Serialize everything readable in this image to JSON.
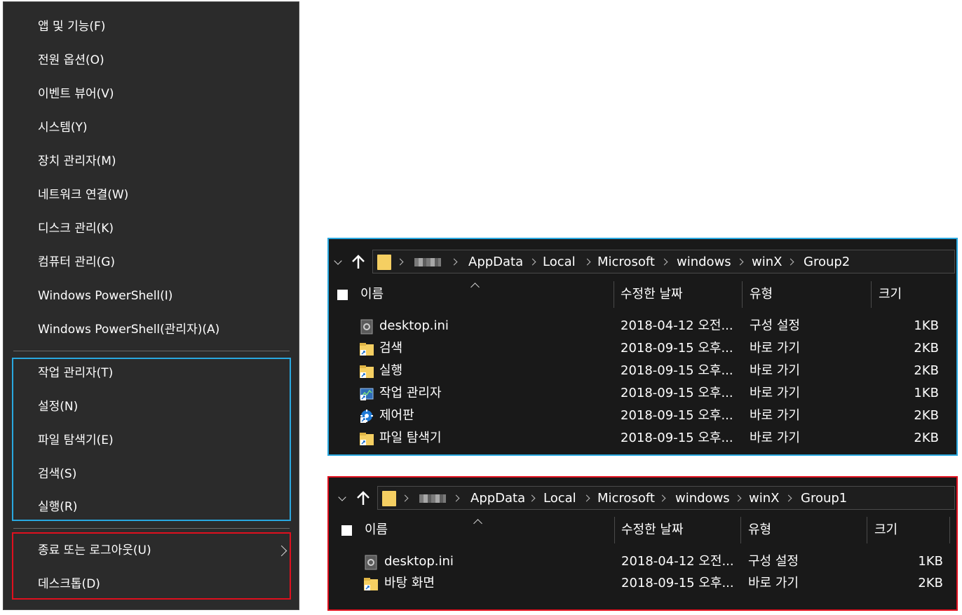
{
  "winx_menu": {
    "items_top": [
      "앱 및 기능(F)",
      "전원 옵션(O)",
      "이벤트 뷰어(V)",
      "시스템(Y)",
      "장치 관리자(M)",
      "네트워크 연결(W)",
      "디스크 관리(K)",
      "컴퓨터 관리(G)",
      "Windows PowerShell(I)",
      "Windows PowerShell(관리자)(A)"
    ],
    "items_group2": [
      "작업 관리자(T)",
      "설정(N)",
      "파일 탐색기(E)",
      "검색(S)",
      "실행(R)"
    ],
    "items_group1": [
      "종료 또는 로그아웃(U)",
      "데스크톱(D)"
    ]
  },
  "colors": {
    "menu_bg": "#2b2b2b",
    "explorer_bg": "#191919",
    "highlight_group2": "#29a8e0",
    "highlight_group1": "#e0101e",
    "folder": "#f5cf62"
  },
  "explorer_group2": {
    "breadcrumb": [
      "AppData",
      "Local",
      "Microsoft",
      "windows",
      "winX",
      "Group2"
    ],
    "columns": [
      "이름",
      "수정한 날짜",
      "유형",
      "크기"
    ],
    "rows": [
      {
        "icon": "ini-file-icon",
        "name": "desktop.ini",
        "date": "2018-04-12 오전...",
        "type": "구성 설정",
        "size": "1KB"
      },
      {
        "icon": "search-shortcut-icon",
        "name": "검색",
        "date": "2018-09-15 오후...",
        "type": "바로 가기",
        "size": "2KB"
      },
      {
        "icon": "run-shortcut-icon",
        "name": "실행",
        "date": "2018-09-15 오후...",
        "type": "바로 가기",
        "size": "2KB"
      },
      {
        "icon": "task-manager-shortcut-icon",
        "name": "작업 관리자",
        "date": "2018-09-15 오후...",
        "type": "바로 가기",
        "size": "1KB"
      },
      {
        "icon": "control-panel-shortcut-icon",
        "name": "제어판",
        "date": "2018-09-15 오후...",
        "type": "바로 가기",
        "size": "2KB"
      },
      {
        "icon": "file-explorer-shortcut-icon",
        "name": "파일 탐색기",
        "date": "2018-09-15 오후...",
        "type": "바로 가기",
        "size": "2KB"
      }
    ]
  },
  "explorer_group1": {
    "breadcrumb": [
      "AppData",
      "Local",
      "Microsoft",
      "windows",
      "winX",
      "Group1"
    ],
    "columns": [
      "이름",
      "수정한 날짜",
      "유형",
      "크기"
    ],
    "rows": [
      {
        "icon": "ini-file-icon",
        "name": "desktop.ini",
        "date": "2018-04-12 오전...",
        "type": "구성 설정",
        "size": "1KB"
      },
      {
        "icon": "desktop-shortcut-icon",
        "name": "바탕 화면",
        "date": "2018-09-15 오후...",
        "type": "바로 가기",
        "size": "2KB"
      }
    ]
  }
}
